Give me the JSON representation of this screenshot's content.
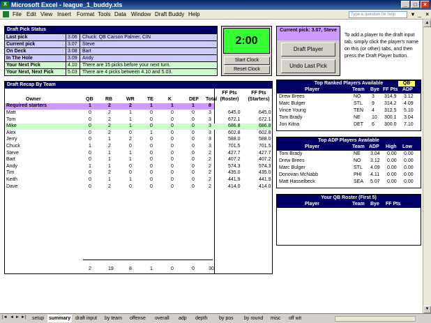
{
  "window": {
    "title": "Microsoft Excel - league_1_buddy.xls",
    "ask_placeholder": "Type a question for help"
  },
  "menu": [
    "File",
    "Edit",
    "View",
    "Insert",
    "Format",
    "Tools",
    "Data",
    "Window",
    "Draft Buddy",
    "Help"
  ],
  "status": {
    "title": "Draft Pick Status",
    "rows": [
      {
        "label": "Last pick",
        "num": "3.06",
        "text": "Chuck: QB Carson Palmer, CIN",
        "style": "blue"
      },
      {
        "label": "Current pick",
        "num": "3.07",
        "text": "Steve",
        "style": "blue"
      },
      {
        "label": "On Deck",
        "num": "3.08",
        "text": "Bart",
        "style": "blue"
      },
      {
        "label": "In The Hole",
        "num": "3.09",
        "text": "Andy",
        "style": "blue"
      },
      {
        "label": "Your Next Pick",
        "num": "4.10",
        "text": "There are 15 picks before your next turn.",
        "style": "green"
      },
      {
        "label": "Your Next, Next Pick",
        "num": "5.03",
        "text": "There are 4 picks between 4.10 and 5.03.",
        "style": "green"
      }
    ]
  },
  "clock": {
    "time": "2:00",
    "start": "Start Clock",
    "reset": "Reset Clock"
  },
  "current_pick_label": "Current pick: 3.07, Steve",
  "draft_player_btn": "Draft Player",
  "undo_btn": "Undo Last Pick",
  "instructions": "To add a player to the draft input tab, simply click the player's name on this (or other) tabs, and then press the Draft Player button.",
  "recap": {
    "title": "Draft Recap By Team",
    "cols": [
      "Owner",
      "QB",
      "RB",
      "WR",
      "TE",
      "K",
      "DEF",
      "Total"
    ],
    "fp_cols": [
      "FF Pts (Roster)",
      "FF Pts (Starters)"
    ],
    "required": [
      "Required starters",
      "1",
      "2",
      "2",
      "1",
      "1",
      "1",
      "8"
    ],
    "rows": [
      [
        "Matt",
        "0",
        "2",
        "1",
        "0",
        "0",
        "0",
        "3",
        "645.0",
        "645.0"
      ],
      [
        "Tom",
        "0",
        "2",
        "1",
        "0",
        "0",
        "0",
        "3",
        "672.1",
        "672.1"
      ],
      [
        "Mike",
        "0",
        "2",
        "1",
        "0",
        "0",
        "0",
        "3",
        "686.8",
        "686.8"
      ],
      [
        "Alex",
        "0",
        "2",
        "0",
        "1",
        "0",
        "0",
        "3",
        "602.8",
        "602.8"
      ],
      [
        "Jerry",
        "0",
        "1",
        "2",
        "0",
        "0",
        "0",
        "3",
        "588.0",
        "588.0"
      ],
      [
        "Chuck",
        "1",
        "2",
        "0",
        "0",
        "0",
        "0",
        "3",
        "701.5",
        "701.5"
      ],
      [
        "Steve",
        "0",
        "1",
        "1",
        "0",
        "0",
        "0",
        "2",
        "427.7",
        "427.7"
      ],
      [
        "Bart",
        "0",
        "1",
        "1",
        "0",
        "0",
        "0",
        "2",
        "407.2",
        "407.2"
      ],
      [
        "Andy",
        "1",
        "1",
        "0",
        "0",
        "0",
        "0",
        "2",
        "574.3",
        "574.3"
      ],
      [
        "Tim",
        "0",
        "2",
        "0",
        "0",
        "0",
        "0",
        "2",
        "435.0",
        "435.0"
      ],
      [
        "Keith",
        "0",
        "1",
        "1",
        "0",
        "0",
        "0",
        "2",
        "441.9",
        "441.9"
      ],
      [
        "Dave",
        "0",
        "2",
        "0",
        "0",
        "0",
        "0",
        "2",
        "414.0",
        "414.0"
      ]
    ],
    "totals": [
      "2",
      "19",
      "8",
      "1",
      "0",
      "0",
      "30"
    ]
  },
  "top_ranked": {
    "title": "Top Ranked Players Available",
    "filter": "QB",
    "cols": [
      "Player",
      "Team",
      "Bye",
      "FF Pts",
      "ADP"
    ],
    "rows": [
      [
        "Drew Brees",
        "NO",
        "3",
        "314.9",
        "3.12"
      ],
      [
        "Marc Bulger",
        "STL",
        "9",
        "314.2",
        "4.09"
      ],
      [
        "Vince Young",
        "TEN",
        "4",
        "312.5",
        "5.10"
      ],
      [
        "Tom Brady",
        "NE",
        "10",
        "300.1",
        "3.04"
      ],
      [
        "Jon Kitna",
        "DET",
        "6",
        "300.0",
        "7.10"
      ]
    ]
  },
  "top_adp": {
    "title": "Top ADP Players Available",
    "cols": [
      "Player",
      "Team",
      "ADP",
      "High",
      "Low"
    ],
    "rows": [
      [
        "Tom Brady",
        "NE",
        "3.04",
        "0.00",
        "0.00"
      ],
      [
        "Drew Brees",
        "NO",
        "3.12",
        "0.00",
        "0.00"
      ],
      [
        "Marc Bulger",
        "STL",
        "4.09",
        "0.00",
        "0.00"
      ],
      [
        "Donovan McNabb",
        "PHI",
        "4.11",
        "0.00",
        "0.00"
      ],
      [
        "Matt Hasselbeck",
        "SEA",
        "5.07",
        "0.00",
        "0.00"
      ]
    ]
  },
  "qb_roster": {
    "title": "Your QB Roster (First 5)",
    "cols": [
      "Player",
      "Team",
      "Bye",
      "FF Pts"
    ]
  },
  "tabs": [
    "setup",
    "summary",
    "draft input",
    "by team",
    "offense",
    "overall",
    "adp",
    "depth",
    "by pos",
    "by round",
    "misc",
    "off wit"
  ],
  "active_tab": "summary"
}
